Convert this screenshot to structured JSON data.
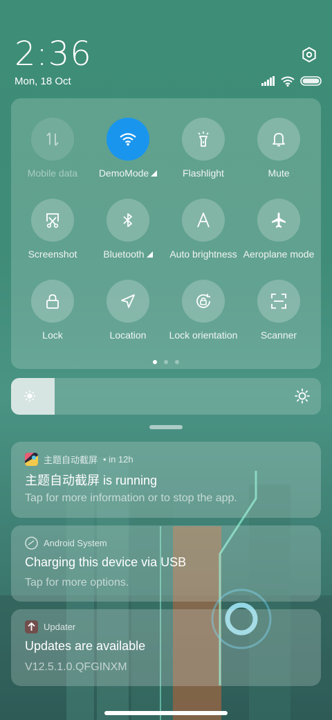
{
  "header": {
    "time": "2:36",
    "date": "Mon, 18 Oct",
    "icons": [
      "settings-icon",
      "signal-icon",
      "wifi-icon",
      "battery-icon"
    ]
  },
  "quick_settings": {
    "tiles": [
      {
        "label": "Mobile data",
        "icon": "mobile-data-icon",
        "state": "disabled"
      },
      {
        "label": "DemoMode",
        "icon": "wifi-icon",
        "state": "active"
      },
      {
        "label": "Flashlight",
        "icon": "flashlight-icon",
        "state": "off"
      },
      {
        "label": "Mute",
        "icon": "bell-icon",
        "state": "off"
      },
      {
        "label": "Screenshot",
        "icon": "scissors-icon",
        "state": "off"
      },
      {
        "label": "Bluetooth",
        "icon": "bluetooth-icon",
        "state": "off"
      },
      {
        "label": "Auto brightness",
        "icon": "auto-brightness-icon",
        "state": "off"
      },
      {
        "label": "Aeroplane mode",
        "icon": "airplane-icon",
        "state": "off"
      },
      {
        "label": "Lock",
        "icon": "lock-icon",
        "state": "off"
      },
      {
        "label": "Location",
        "icon": "location-icon",
        "state": "off"
      },
      {
        "label": "Lock orientation",
        "icon": "rotation-lock-icon",
        "state": "off"
      },
      {
        "label": "Scanner",
        "icon": "scanner-icon",
        "state": "off"
      }
    ],
    "page_count": 3,
    "active_page": 1
  },
  "brightness": {
    "level": 0.14
  },
  "notifications": [
    {
      "app": "主题自动截屏",
      "meta": "• in 12h",
      "title": "主题自动截屏 is running",
      "body": "Tap for more information or to stop the app."
    },
    {
      "app": "Android System",
      "meta": "",
      "title": "Charging this device via USB",
      "body": "Tap for more options."
    },
    {
      "app": "Updater",
      "meta": "",
      "title": "Updates are available",
      "body": "V12.5.1.0.QFGINXM"
    }
  ],
  "colors": {
    "accent": "#1a95ee",
    "background": "#3f8c78"
  }
}
